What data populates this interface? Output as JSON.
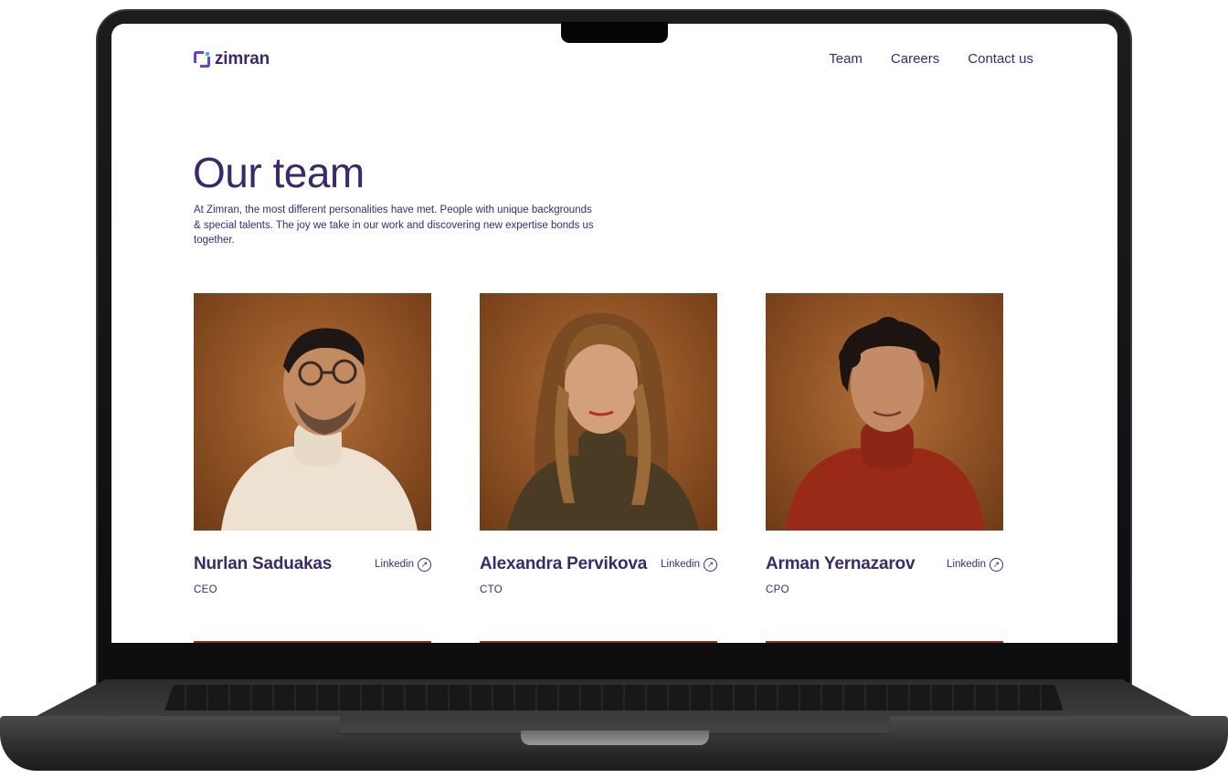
{
  "site": {
    "logo_text": "zimran",
    "nav": [
      {
        "label": "Team"
      },
      {
        "label": "Careers"
      },
      {
        "label": "Contact us"
      }
    ]
  },
  "hero": {
    "title": "Our team",
    "description": "At Zimran, the most different personalities have met. People with unique backgrounds & special talents. The joy we take in our work and discovering new expertise bonds us together."
  },
  "team": [
    {
      "name": "Nurlan Saduakas",
      "role": "CEO",
      "link_label": "Linkedin",
      "link_icon": "arrow-up-right-circle-icon",
      "sweater_color": "#ede2d2"
    },
    {
      "name": "Alexandra Pervikova",
      "role": "CTO",
      "link_label": "Linkedin",
      "link_icon": "arrow-up-right-circle-icon",
      "sweater_color": "#4a3b24"
    },
    {
      "name": "Arman Yernazarov",
      "role": "CPO",
      "link_label": "Linkedin",
      "link_icon": "arrow-up-right-circle-icon",
      "sweater_color": "#9a2a18"
    }
  ],
  "colors": {
    "brand_text": "#3b2a6b",
    "logo_purple": "#6b3fd1",
    "logo_accent": "#2ec4a7",
    "photo_background": "#8f5224"
  }
}
